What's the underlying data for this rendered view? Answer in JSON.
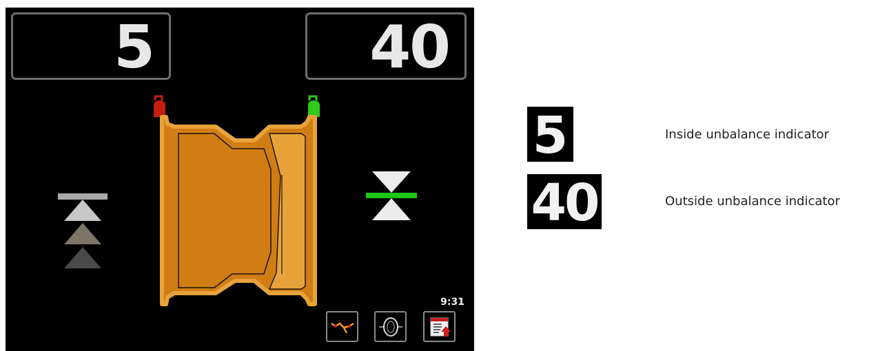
{
  "display": {
    "inside_value": "5",
    "outside_value": "40",
    "clock": "9:31",
    "inside_weight_indicator": "red",
    "outside_weight_indicator": "green",
    "inside_position_status": "off-position",
    "outside_position_status": "in-position"
  },
  "toolbar": {
    "buttons": [
      {
        "icon": "rim-measure-icon"
      },
      {
        "icon": "wheel-balance-icon"
      },
      {
        "icon": "menu-upload-icon"
      }
    ]
  },
  "legend": {
    "inside": {
      "badge": "5",
      "label": "Inside unbalance indicator"
    },
    "outside": {
      "badge": "40",
      "label": "Outside unbalance indicator"
    }
  },
  "colors": {
    "screen_background": "#000000",
    "rim_orange": "#d07d14",
    "rim_light": "#e7a33a",
    "weight_red": "#c41e10",
    "weight_green": "#2ecb1a",
    "position_bar_green": "#1fc41b",
    "frame_gray": "#6e6e6e"
  }
}
